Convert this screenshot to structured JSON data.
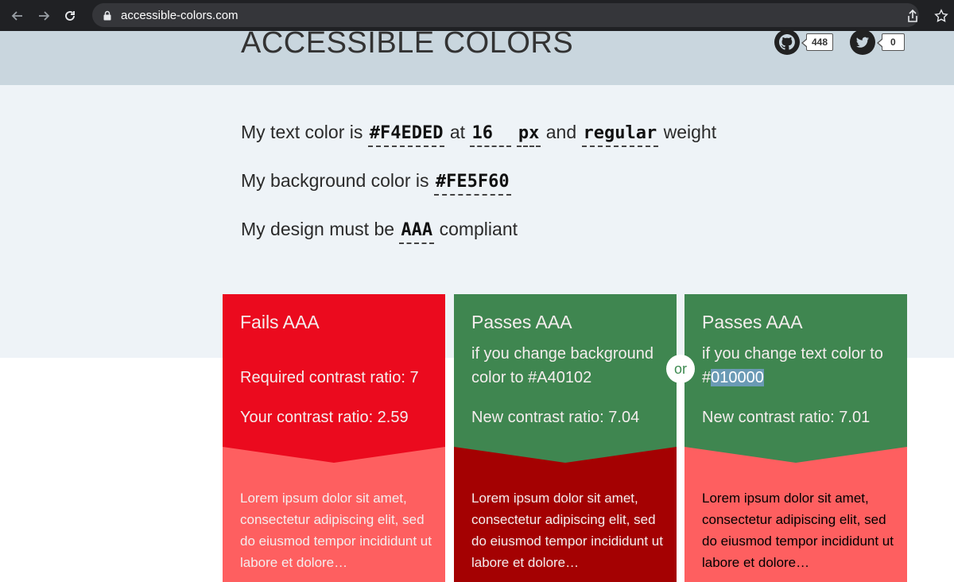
{
  "browser": {
    "url": "accessible-colors.com"
  },
  "header": {
    "title": "ACCESSIBLE COLORS",
    "github_count": "448",
    "twitter_count": "0"
  },
  "form": {
    "line1": {
      "prefix": "My text color is",
      "text_color": "#F4EDED",
      "at": "at",
      "font_size": "16",
      "unit": "px",
      "and": "and",
      "weight": "regular",
      "suffix": "weight"
    },
    "line2": {
      "prefix": "My background color is",
      "bg_color": "#FE5F60"
    },
    "line3": {
      "prefix": "My design must be",
      "level": "AAA",
      "suffix": "compliant"
    }
  },
  "cards": {
    "fail": {
      "heading": "Fails AAA",
      "required": "Required contrast ratio: 7",
      "yours": "Your contrast ratio: 2.59",
      "lorem": "Lorem ipsum dolor sit amet, consectetur adipiscing elit, sed do eiusmod tempor incididunt ut labore et dolore…",
      "top_color": "#eb0a1e",
      "bottom_color": "#fe5f60",
      "text_color": "#f4eded"
    },
    "pass_bg": {
      "heading": "Passes AAA",
      "line1": "if you change background",
      "line2": "color to #A40102",
      "ratio": "New contrast ratio: 7.04",
      "lorem": "Lorem ipsum dolor sit amet, consectetur adipiscing elit, sed do eiusmod tempor incididunt ut labore et dolore…",
      "top_color": "#3f8650",
      "bottom_color": "#a40102",
      "text_color": "#f4eded"
    },
    "pass_text": {
      "heading": "Passes AAA",
      "line1": "if you change text color to",
      "hash": "#",
      "color_value": "010000",
      "ratio": "New contrast ratio: 7.01",
      "lorem": "Lorem ipsum dolor sit amet, consectetur adipiscing elit, sed do eiusmod tempor incididunt ut labore et dolore…",
      "top_color": "#3f8650",
      "bottom_color": "#fe5f60",
      "text_color": "#010000"
    }
  },
  "or_label": "or"
}
